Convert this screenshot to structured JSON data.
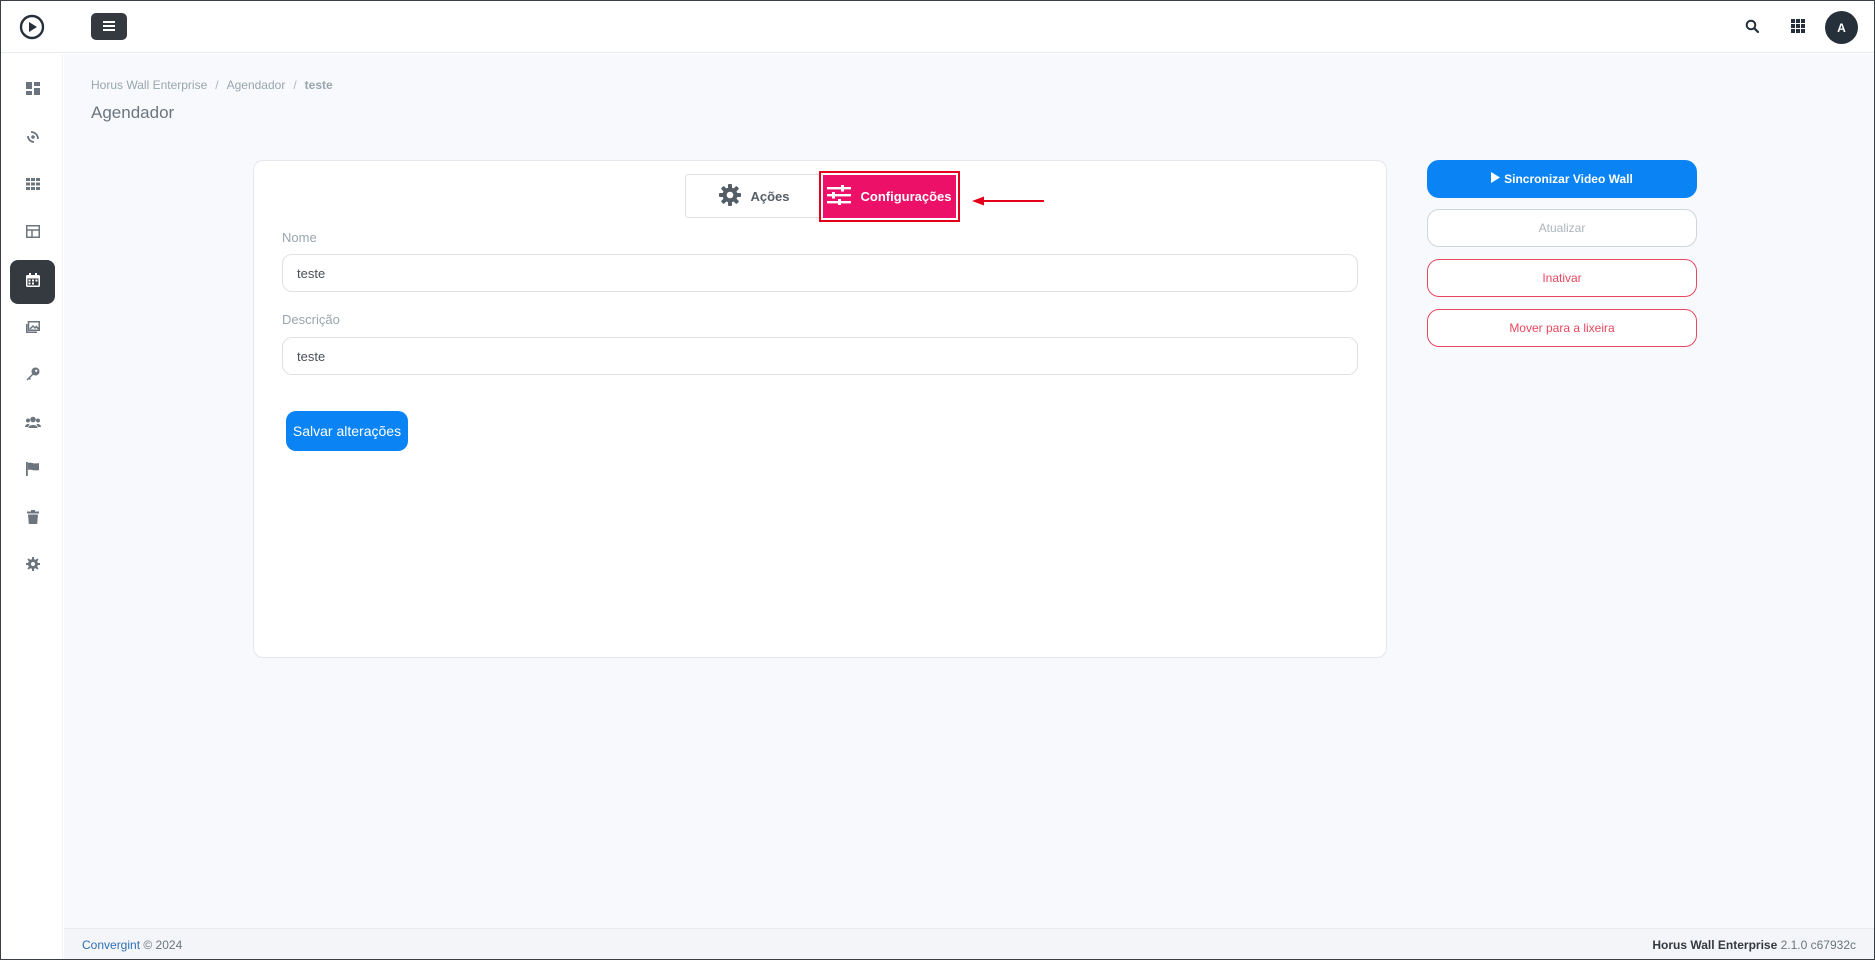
{
  "header": {
    "menu_icon": "hamburger-icon",
    "search_icon": "search-icon",
    "apps_icon": "apps-grid-icon",
    "avatar_initial": "A"
  },
  "sidebar": {
    "items": [
      {
        "icon": "dashboard-icon",
        "active": false
      },
      {
        "icon": "satellite-icon",
        "active": false
      },
      {
        "icon": "grid-icon",
        "active": false
      },
      {
        "icon": "layout-icon",
        "active": false
      },
      {
        "icon": "calendar-icon",
        "active": true
      },
      {
        "icon": "media-icon",
        "active": false
      },
      {
        "icon": "key-icon",
        "active": false
      },
      {
        "icon": "users-icon",
        "active": false
      },
      {
        "icon": "flag-icon",
        "active": false
      },
      {
        "icon": "trash-icon",
        "active": false
      },
      {
        "icon": "gear-icon",
        "active": false
      }
    ]
  },
  "breadcrumb": {
    "items": [
      "Horus Wall Enterprise",
      "Agendador",
      "teste"
    ],
    "separator": "/"
  },
  "page": {
    "title": "Agendador"
  },
  "tabs": {
    "acoes": "Ações",
    "configuracoes": "Configurações",
    "active": "configuracoes"
  },
  "form": {
    "name_label": "Nome",
    "name_value": "teste",
    "description_label": "Descrição",
    "description_value": "teste",
    "save_label": "Salvar alterações"
  },
  "actions": {
    "sync_label": "Sincronizar Video Wall",
    "update_label": "Atualizar",
    "inactivate_label": "Inativar",
    "trash_label": "Mover para a lixeira"
  },
  "footer": {
    "company_link": "Convergint",
    "copyright": "© 2024",
    "product_name": "Horus Wall Enterprise",
    "version": "2.1.0 c67932c"
  },
  "colors": {
    "primary": "#0a84f5",
    "active_tab": "#ec1068",
    "danger": "#e8485f",
    "dark": "#343a40",
    "highlight_annotation": "#e3001b"
  }
}
